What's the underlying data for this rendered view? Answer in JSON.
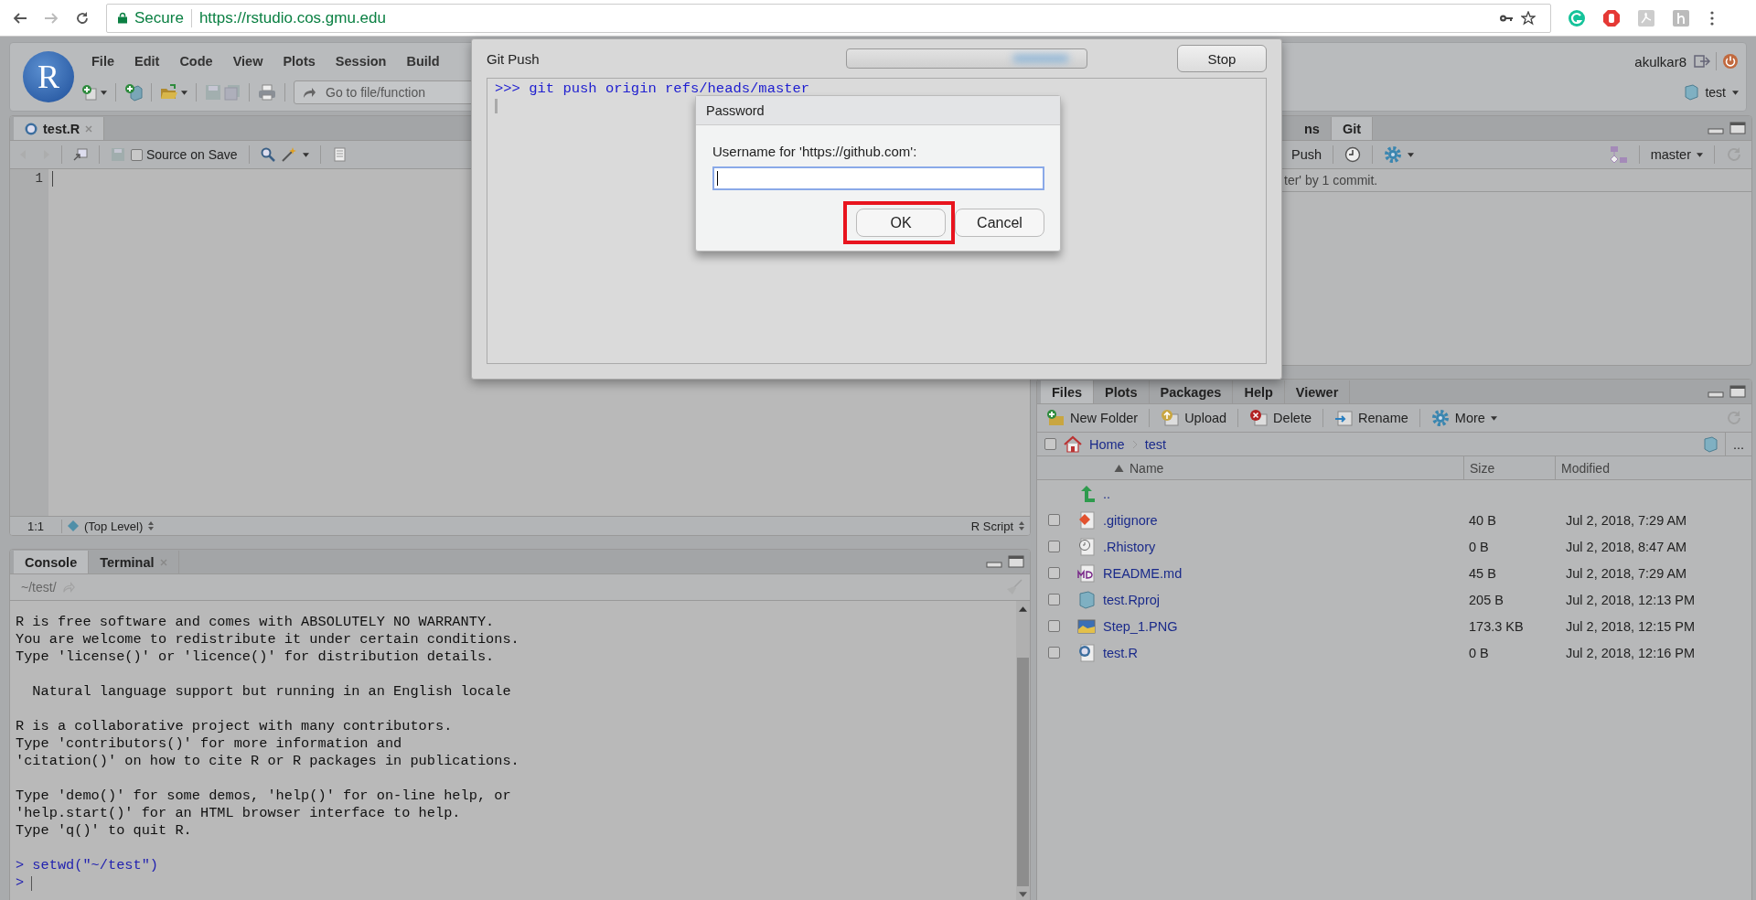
{
  "browser": {
    "secure": "Secure",
    "url": "https://rstudio.cos.gmu.edu"
  },
  "rstudio": {
    "logo": "R",
    "menu": [
      "File",
      "Edit",
      "Code",
      "View",
      "Plots",
      "Session",
      "Build"
    ],
    "goto_placeholder": "Go to file/function",
    "user": "akulkar8",
    "project": "test"
  },
  "editor": {
    "tabs": [
      {
        "label": "test.R",
        "selected": true
      }
    ],
    "source_on_save": {
      "label": "Source on Save",
      "checked": false
    },
    "line_numbers": [
      "1"
    ],
    "status": {
      "position": "1:1",
      "scope": "(Top Level)",
      "type": "R Script"
    }
  },
  "console": {
    "tabs": [
      {
        "label": "Console",
        "selected": true,
        "closable": false
      },
      {
        "label": "Terminal",
        "selected": false,
        "closable": true
      }
    ],
    "path": "~/test/",
    "lines": [
      {
        "kind": "output",
        "text": "R is free software and comes with ABSOLUTELY NO WARRANTY."
      },
      {
        "kind": "output",
        "text": "You are welcome to redistribute it under certain conditions."
      },
      {
        "kind": "output",
        "text": "Type 'license()' or 'licence()' for distribution details."
      },
      {
        "kind": "blank"
      },
      {
        "kind": "output",
        "text": "  Natural language support but running in an English locale"
      },
      {
        "kind": "blank"
      },
      {
        "kind": "output",
        "text": "R is a collaborative project with many contributors."
      },
      {
        "kind": "output",
        "text": "Type 'contributors()' for more information and"
      },
      {
        "kind": "output",
        "text": "'citation()' on how to cite R or R packages in publications."
      },
      {
        "kind": "blank"
      },
      {
        "kind": "output",
        "text": "Type 'demo()' for some demos, 'help()' for on-line help, or"
      },
      {
        "kind": "output",
        "text": "'help.start()' for an HTML browser interface to help."
      },
      {
        "kind": "output",
        "text": "Type 'q()' to quit R."
      },
      {
        "kind": "blank"
      },
      {
        "kind": "input",
        "text": "> setwd(\"~/test\")"
      },
      {
        "kind": "prompt",
        "text": ">"
      }
    ]
  },
  "git_pane": {
    "tabs": [
      {
        "label": "ns",
        "selected": false
      },
      {
        "label": "Git",
        "selected": true
      }
    ],
    "push": "Push",
    "branch": "master",
    "message": "ter' by 1 commit."
  },
  "files_pane": {
    "tabs": [
      {
        "label": "Files",
        "selected": true
      },
      {
        "label": "Plots",
        "selected": false
      },
      {
        "label": "Packages",
        "selected": false
      },
      {
        "label": "Help",
        "selected": false
      },
      {
        "label": "Viewer",
        "selected": false
      }
    ],
    "toolbar": [
      {
        "kind": "new-folder",
        "label": "New Folder"
      },
      {
        "kind": "upload",
        "label": "Upload"
      },
      {
        "kind": "delete",
        "label": "Delete"
      },
      {
        "kind": "rename",
        "label": "Rename"
      },
      {
        "kind": "more",
        "label": "More"
      }
    ],
    "select_all_checked": false,
    "breadcrumb": [
      "Home",
      "test"
    ],
    "path_menu": "...",
    "columns": [
      "Name",
      "Size",
      "Modified"
    ],
    "parent": "..",
    "rows": [
      {
        "kind": "git",
        "name": ".gitignore",
        "size": "40 B",
        "modified": "Jul 2, 2018, 7:29 AM",
        "checked": false
      },
      {
        "kind": "history",
        "name": ".Rhistory",
        "size": "0 B",
        "modified": "Jul 2, 2018, 8:47 AM",
        "checked": false
      },
      {
        "kind": "markdown",
        "name": "README.md",
        "size": "45 B",
        "modified": "Jul 2, 2018, 7:29 AM",
        "checked": false
      },
      {
        "kind": "rproj",
        "name": "test.Rproj",
        "size": "205 B",
        "modified": "Jul 2, 2018, 12:13 PM",
        "checked": false
      },
      {
        "kind": "image",
        "name": "Step_1.PNG",
        "size": "173.3 KB",
        "modified": "Jul 2, 2018, 12:15 PM",
        "checked": false
      },
      {
        "kind": "r",
        "name": "test.R",
        "size": "0 B",
        "modified": "Jul 2, 2018, 12:16 PM",
        "checked": false
      }
    ]
  },
  "git_push_dialog": {
    "title": "Git Push",
    "command": ">>> git push origin refs/heads/master",
    "stop": "Stop",
    "busy": true
  },
  "password_dialog": {
    "title": "Password",
    "prompt": "Username for 'https://github.com':",
    "ok": "OK",
    "cancel": "Cancel",
    "ok_highlighted": true
  }
}
